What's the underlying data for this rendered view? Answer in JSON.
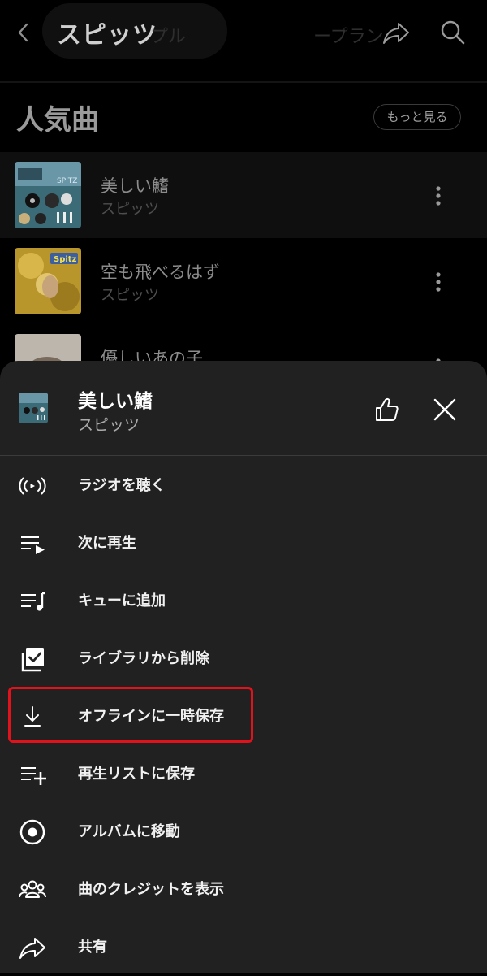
{
  "header": {
    "artist_title": "スピッツ",
    "ghost_text_a": "プル",
    "ghost_text_b": "ープラン"
  },
  "section": {
    "title": "人気曲",
    "more_label": "もっと見る"
  },
  "songs": [
    {
      "title": "美しい鰭",
      "artist": "スピッツ"
    },
    {
      "title": "空も飛べるはず",
      "artist": "スピッツ"
    },
    {
      "title": "優しいあの子",
      "artist": ""
    }
  ],
  "album_art_2_logo": "Spitz",
  "album_art_1_logo": "SPITZ",
  "sheet": {
    "song_title": "美しい鰭",
    "song_artist": "スピッツ",
    "menu": [
      {
        "label": "ラジオを聴く",
        "icon": "radio-icon"
      },
      {
        "label": "次に再生",
        "icon": "play-next-icon"
      },
      {
        "label": "キューに追加",
        "icon": "add-to-queue-icon"
      },
      {
        "label": "ライブラリから削除",
        "icon": "library-remove-icon"
      },
      {
        "label": "オフラインに一時保存",
        "icon": "download-icon"
      },
      {
        "label": "再生リストに保存",
        "icon": "playlist-add-icon"
      },
      {
        "label": "アルバムに移動",
        "icon": "album-icon"
      },
      {
        "label": "曲のクレジットを表示",
        "icon": "credits-icon"
      },
      {
        "label": "共有",
        "icon": "share-icon"
      }
    ]
  },
  "colors": {
    "sheet_background": "#212121",
    "highlight_border": "#e0121c",
    "page_background": "#000000"
  }
}
